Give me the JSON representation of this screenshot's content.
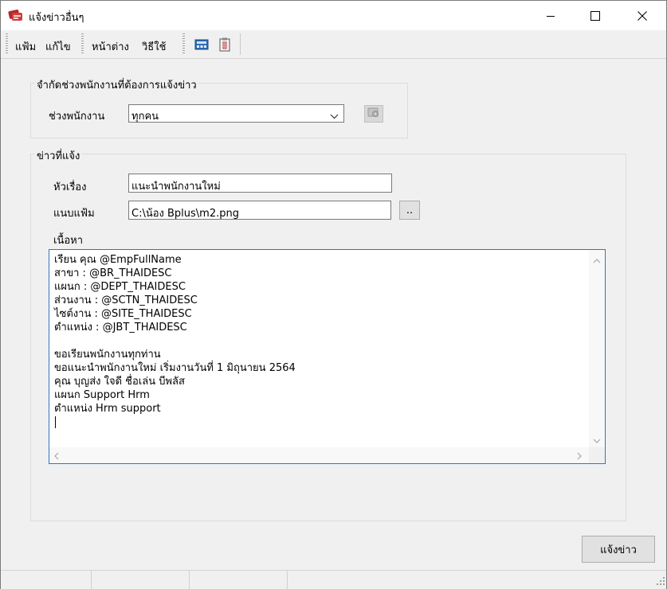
{
  "window": {
    "title": "แจ้งข่าวอื่นๆ",
    "controls": [
      "minimize-icon",
      "maximize-icon",
      "close-icon"
    ]
  },
  "menu": {
    "items": [
      "แฟ้ม",
      "แก้ไข",
      "หน้าต่าง",
      "วิธีใช้"
    ],
    "toolbar_icons": [
      "calculator-icon",
      "clipboard-icon"
    ]
  },
  "employee_range_group": {
    "title": "จำกัดช่วงพนักงานที่ต้องการแจ้งข่าว",
    "label": "ช่วงพนักงาน",
    "selected": "ทุกคน",
    "button_icon": "filter-settings-icon"
  },
  "news_group": {
    "title": "ข่าวที่แจ้ง",
    "subject_label": "หัวเรื่อง",
    "subject_value": "แนะนำพนักงานใหม่",
    "attachment_label": "แนบแฟ้ม",
    "attachment_value": "C:\\น้อง Bplus\\m2.png",
    "browse_label": "..",
    "content_label": "เนื้อหา",
    "content_lines": [
      "เรียน คุณ @EmpFullName",
      "สาขา : @BR_THAIDESC",
      "แผนก : @DEPT_THAIDESC",
      "ส่วนงาน : @SCTN_THAIDESC",
      "ไซต์งาน : @SITE_THAIDESC",
      "ตำแหน่ง : @JBT_THAIDESC",
      "",
      "ขอเรียนพนักงานทุกท่าน",
      "ขอแนะนำพนักงานใหม่ เริ่มงานวันที่ 1 มิถุนายน 2564",
      "คุณ บุญส่ง ใจดี ชื่อเล่น บีพลัส",
      "แผนก Support Hrm",
      "ตำแหน่ง Hrm support"
    ]
  },
  "actions": {
    "notify_label": "แจ้งข่าว"
  },
  "colors": {
    "focus_border": "#2b76c7",
    "window_bg": "#f0f0f0",
    "button_bg": "#e1e1e1"
  }
}
